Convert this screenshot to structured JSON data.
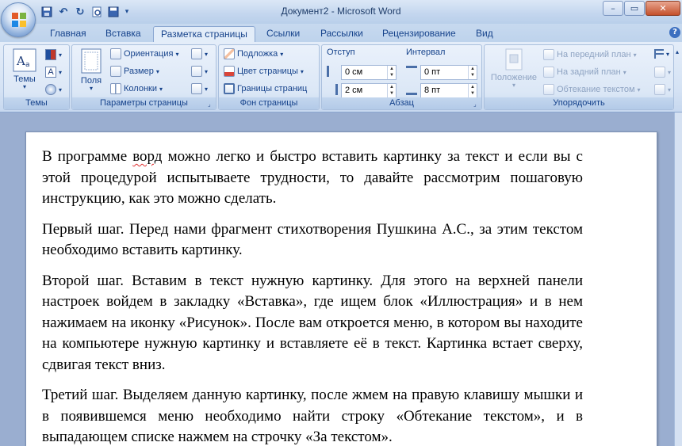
{
  "window": {
    "title": "Документ2 - Microsoft Word",
    "controls": {
      "minimize": "–",
      "restore": "▭",
      "close": "✕"
    }
  },
  "qat": {
    "save_icon": "save-icon",
    "undo_icon": "undo-icon",
    "redo_icon": "redo-icon"
  },
  "tabs": [
    {
      "label": "Главная"
    },
    {
      "label": "Вставка"
    },
    {
      "label": "Разметка страницы"
    },
    {
      "label": "Ссылки"
    },
    {
      "label": "Рассылки"
    },
    {
      "label": "Рецензирование"
    },
    {
      "label": "Вид"
    }
  ],
  "ribbon": {
    "themes": {
      "label": "Темы",
      "button": "Темы"
    },
    "page_setup": {
      "label": "Параметры страницы",
      "fields": "Поля",
      "orientation": "Ориентация",
      "size": "Размер",
      "columns": "Колонки"
    },
    "page_background": {
      "label": "Фон страницы",
      "watermark": "Подложка",
      "page_color": "Цвет страницы",
      "page_borders": "Границы страниц"
    },
    "paragraph": {
      "label": "Абзац",
      "indent_title": "Отступ",
      "spacing_title": "Интервал",
      "indent_left": "0 см",
      "indent_right": "2 см",
      "spacing_before": "0 пт",
      "spacing_after": "8 пт"
    },
    "arrange": {
      "label": "Упорядочить",
      "position": "Положение",
      "bring_front": "На передний план",
      "send_back": "На задний план",
      "text_wrap": "Обтекание текстом"
    }
  },
  "document": {
    "p1_word": "ворд",
    "p1_before": "В программе ",
    "p1_after": " можно легко и быстро вставить картинку за текст и если вы с этой процедурой испытываете трудности, то давайте рассмотрим пошаговую инструкцию, как это можно сделать.",
    "p2": "Первый шаг. Перед нами фрагмент стихотворения Пушкина А.С., за этим текстом необходимо вставить картинку.",
    "p3": "Второй шаг. Вставим в текст нужную картинку. Для этого на верхней панели настроек войдем в закладку «Вставка», где ищем блок «Иллюстрация» и в нем нажимаем на иконку «Рисунок». После вам откроется меню, в котором вы находите на компьютере нужную картинку и вставляете её в текст. Картинка встает сверху, сдвигая текст вниз.",
    "p4": "Третий шаг. Выделяем данную картинку, после жмем на правую клавишу мышки и в появившемся меню необходимо найти строку «Обтекание текстом», и в выпадающем списке нажмем на строчку «За текстом»."
  }
}
